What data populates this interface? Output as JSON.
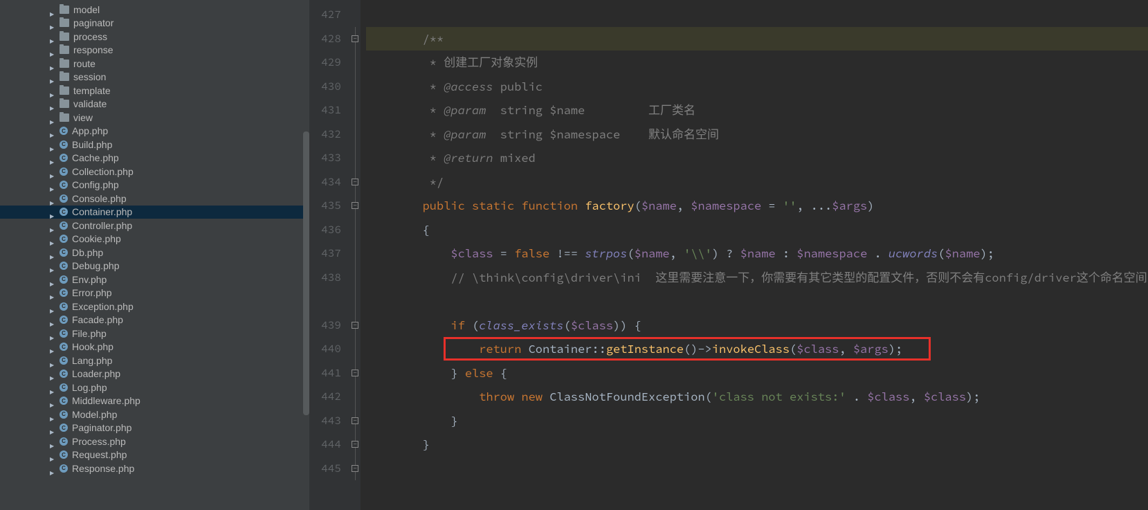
{
  "sidebar": {
    "folders": [
      {
        "label": "model"
      },
      {
        "label": "paginator"
      },
      {
        "label": "process"
      },
      {
        "label": "response"
      },
      {
        "label": "route"
      },
      {
        "label": "session"
      },
      {
        "label": "template"
      },
      {
        "label": "validate"
      },
      {
        "label": "view"
      }
    ],
    "files": [
      {
        "label": "App.php",
        "selected": false
      },
      {
        "label": "Build.php",
        "selected": false
      },
      {
        "label": "Cache.php",
        "selected": false
      },
      {
        "label": "Collection.php",
        "selected": false
      },
      {
        "label": "Config.php",
        "selected": false
      },
      {
        "label": "Console.php",
        "selected": false
      },
      {
        "label": "Container.php",
        "selected": true
      },
      {
        "label": "Controller.php",
        "selected": false
      },
      {
        "label": "Cookie.php",
        "selected": false
      },
      {
        "label": "Db.php",
        "selected": false
      },
      {
        "label": "Debug.php",
        "selected": false
      },
      {
        "label": "Env.php",
        "selected": false
      },
      {
        "label": "Error.php",
        "selected": false
      },
      {
        "label": "Exception.php",
        "selected": false
      },
      {
        "label": "Facade.php",
        "selected": false
      },
      {
        "label": "File.php",
        "selected": false
      },
      {
        "label": "Hook.php",
        "selected": false
      },
      {
        "label": "Lang.php",
        "selected": false
      },
      {
        "label": "Loader.php",
        "selected": false
      },
      {
        "label": "Log.php",
        "selected": false
      },
      {
        "label": "Middleware.php",
        "selected": false
      },
      {
        "label": "Model.php",
        "selected": false
      },
      {
        "label": "Paginator.php",
        "selected": false
      },
      {
        "label": "Process.php",
        "selected": false
      },
      {
        "label": "Request.php",
        "selected": false
      },
      {
        "label": "Response.php",
        "selected": false
      }
    ]
  },
  "code": {
    "lines": [
      {
        "n": "427",
        "fold": "",
        "content": []
      },
      {
        "n": "428",
        "fold": "mark",
        "hl": true,
        "content": [
          {
            "cls": "c-comment",
            "t": "        /**"
          }
        ]
      },
      {
        "n": "429",
        "fold": "line",
        "content": [
          {
            "cls": "c-comment",
            "t": "         * 创建工厂对象实例"
          }
        ]
      },
      {
        "n": "430",
        "fold": "line",
        "content": [
          {
            "cls": "c-comment",
            "t": "         * "
          },
          {
            "cls": "c-dtag",
            "t": "@access"
          },
          {
            "cls": "c-comment",
            "t": " public"
          }
        ]
      },
      {
        "n": "431",
        "fold": "line",
        "content": [
          {
            "cls": "c-comment",
            "t": "         * "
          },
          {
            "cls": "c-dtag",
            "t": "@param"
          },
          {
            "cls": "c-comment",
            "t": "  string $name         工厂类名"
          }
        ]
      },
      {
        "n": "432",
        "fold": "line",
        "content": [
          {
            "cls": "c-comment",
            "t": "         * "
          },
          {
            "cls": "c-dtag",
            "t": "@param"
          },
          {
            "cls": "c-comment",
            "t": "  string $namespace    默认命名空间"
          }
        ]
      },
      {
        "n": "433",
        "fold": "line",
        "content": [
          {
            "cls": "c-comment",
            "t": "         * "
          },
          {
            "cls": "c-dtag",
            "t": "@return"
          },
          {
            "cls": "c-comment",
            "t": " mixed"
          }
        ]
      },
      {
        "n": "434",
        "fold": "mark",
        "content": [
          {
            "cls": "c-comment",
            "t": "         */"
          }
        ]
      },
      {
        "n": "435",
        "fold": "mark",
        "content": [
          {
            "cls": "c-txt",
            "t": "        "
          },
          {
            "cls": "c-kw",
            "t": "public static function "
          },
          {
            "cls": "c-fn",
            "t": "factory"
          },
          {
            "cls": "c-txt",
            "t": "("
          },
          {
            "cls": "c-var",
            "t": "$name"
          },
          {
            "cls": "c-txt",
            "t": ", "
          },
          {
            "cls": "c-var",
            "t": "$namespace"
          },
          {
            "cls": "c-txt",
            "t": " = "
          },
          {
            "cls": "c-str",
            "t": "''"
          },
          {
            "cls": "c-txt",
            "t": ", ..."
          },
          {
            "cls": "c-var",
            "t": "$args"
          },
          {
            "cls": "c-txt",
            "t": ")"
          }
        ]
      },
      {
        "n": "436",
        "fold": "line",
        "content": [
          {
            "cls": "c-txt",
            "t": "        {"
          }
        ]
      },
      {
        "n": "437",
        "fold": "line",
        "content": [
          {
            "cls": "c-txt",
            "t": "            "
          },
          {
            "cls": "c-var",
            "t": "$class"
          },
          {
            "cls": "c-txt",
            "t": " = "
          },
          {
            "cls": "c-const",
            "t": "false"
          },
          {
            "cls": "c-txt",
            "t": " !== "
          },
          {
            "cls": "c-builtin",
            "t": "strpos"
          },
          {
            "cls": "c-txt",
            "t": "("
          },
          {
            "cls": "c-var",
            "t": "$name"
          },
          {
            "cls": "c-txt",
            "t": ", "
          },
          {
            "cls": "c-str",
            "t": "'\\\\'"
          },
          {
            "cls": "c-txt",
            "t": ") ? "
          },
          {
            "cls": "c-var",
            "t": "$name"
          },
          {
            "cls": "c-txt",
            "t": " : "
          },
          {
            "cls": "c-var",
            "t": "$namespace"
          },
          {
            "cls": "c-txt",
            "t": " . "
          },
          {
            "cls": "c-builtin",
            "t": "ucwords"
          },
          {
            "cls": "c-txt",
            "t": "("
          },
          {
            "cls": "c-var",
            "t": "$name"
          },
          {
            "cls": "c-txt",
            "t": ");"
          }
        ]
      },
      {
        "n": "438",
        "fold": "line",
        "content": [
          {
            "cls": "c-txt",
            "t": "            "
          },
          {
            "cls": "c-comment",
            "t": "// \\think\\config\\driver\\ini  这里需要注意一下，你需要有其它类型的配置文件，否则不会有config/driver这个命名空间"
          }
        ]
      },
      {
        "n": "439",
        "fold": "mark",
        "content": [
          {
            "cls": "c-txt",
            "t": "            "
          },
          {
            "cls": "c-kw",
            "t": "if"
          },
          {
            "cls": "c-txt",
            "t": " ("
          },
          {
            "cls": "c-builtin",
            "t": "class_exists"
          },
          {
            "cls": "c-txt",
            "t": "("
          },
          {
            "cls": "c-var",
            "t": "$class"
          },
          {
            "cls": "c-txt",
            "t": ")) {"
          }
        ]
      },
      {
        "n": "440",
        "fold": "line",
        "redbox": true,
        "content": [
          {
            "cls": "c-txt",
            "t": "                "
          },
          {
            "cls": "c-kw",
            "t": "return "
          },
          {
            "cls": "c-txt",
            "t": "Container::"
          },
          {
            "cls": "c-call",
            "t": "getInstance"
          },
          {
            "cls": "c-txt",
            "t": "()->"
          },
          {
            "cls": "c-call",
            "t": "invokeClass"
          },
          {
            "cls": "c-txt",
            "t": "("
          },
          {
            "cls": "c-var",
            "t": "$class"
          },
          {
            "cls": "c-txt",
            "t": ", "
          },
          {
            "cls": "c-var",
            "t": "$args"
          },
          {
            "cls": "c-txt",
            "t": ");"
          }
        ]
      },
      {
        "n": "441",
        "fold": "mark",
        "content": [
          {
            "cls": "c-txt",
            "t": "            } "
          },
          {
            "cls": "c-kw",
            "t": "else"
          },
          {
            "cls": "c-txt",
            "t": " {"
          }
        ]
      },
      {
        "n": "442",
        "fold": "line",
        "content": [
          {
            "cls": "c-txt",
            "t": "                "
          },
          {
            "cls": "c-kw",
            "t": "throw new "
          },
          {
            "cls": "c-txt",
            "t": "ClassNotFoundException("
          },
          {
            "cls": "c-str",
            "t": "'class not exists:' "
          },
          {
            "cls": "c-txt",
            "t": ". "
          },
          {
            "cls": "c-var",
            "t": "$class"
          },
          {
            "cls": "c-txt",
            "t": ", "
          },
          {
            "cls": "c-var",
            "t": "$class"
          },
          {
            "cls": "c-txt",
            "t": ");"
          }
        ]
      },
      {
        "n": "443",
        "fold": "mark",
        "content": [
          {
            "cls": "c-txt",
            "t": "            }"
          }
        ]
      },
      {
        "n": "444",
        "fold": "mark",
        "content": [
          {
            "cls": "c-txt",
            "t": "        }"
          }
        ]
      },
      {
        "n": "445",
        "fold": "mark",
        "content": []
      }
    ]
  }
}
